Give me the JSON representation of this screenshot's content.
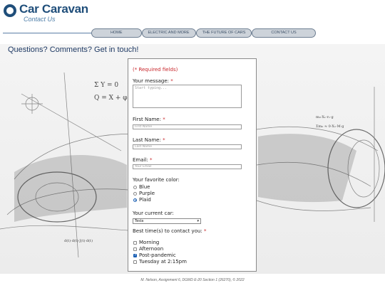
{
  "brand": {
    "title": "Car Caravan",
    "subtitle": "Contact Us"
  },
  "nav": {
    "items": [
      "HOME",
      "ELECTRIC AND MORE",
      "THE FUTURE OF CARS",
      "CONTACT US"
    ]
  },
  "page": {
    "heading": "Questions? Comments? Get in touch!"
  },
  "form": {
    "required_note": "(* Required fields)",
    "message_label": "Your message:",
    "message_placeholder": "Start typing...",
    "first_name_label": "First Name:",
    "first_name_placeholder": "First Name",
    "last_name_label": "Last Name:",
    "last_name_placeholder": "Last Name",
    "email_label": "Email:",
    "email_placeholder": "Your Email",
    "color_label": "Your favorite color:",
    "colors": [
      {
        "label": "Blue",
        "checked": false
      },
      {
        "label": "Purple",
        "checked": false
      },
      {
        "label": "Plaid",
        "checked": true
      }
    ],
    "car_label": "Your current car:",
    "car_selected": "Tesla",
    "times_label": "Best time(s) to contact you:",
    "times": [
      {
        "label": "Morning",
        "checked": false
      },
      {
        "label": "Afternoon",
        "checked": false
      },
      {
        "label": "Post-pandemic",
        "checked": true
      },
      {
        "label": "Tuesday at 2:15pm",
        "checked": false
      }
    ],
    "accent_color": "#1a5fb4",
    "required_color": "#c8262b"
  },
  "footer": {
    "text": "M. Nelson, Assignment 6, DGMD E-20 Section 1 (26270), © 2022"
  }
}
